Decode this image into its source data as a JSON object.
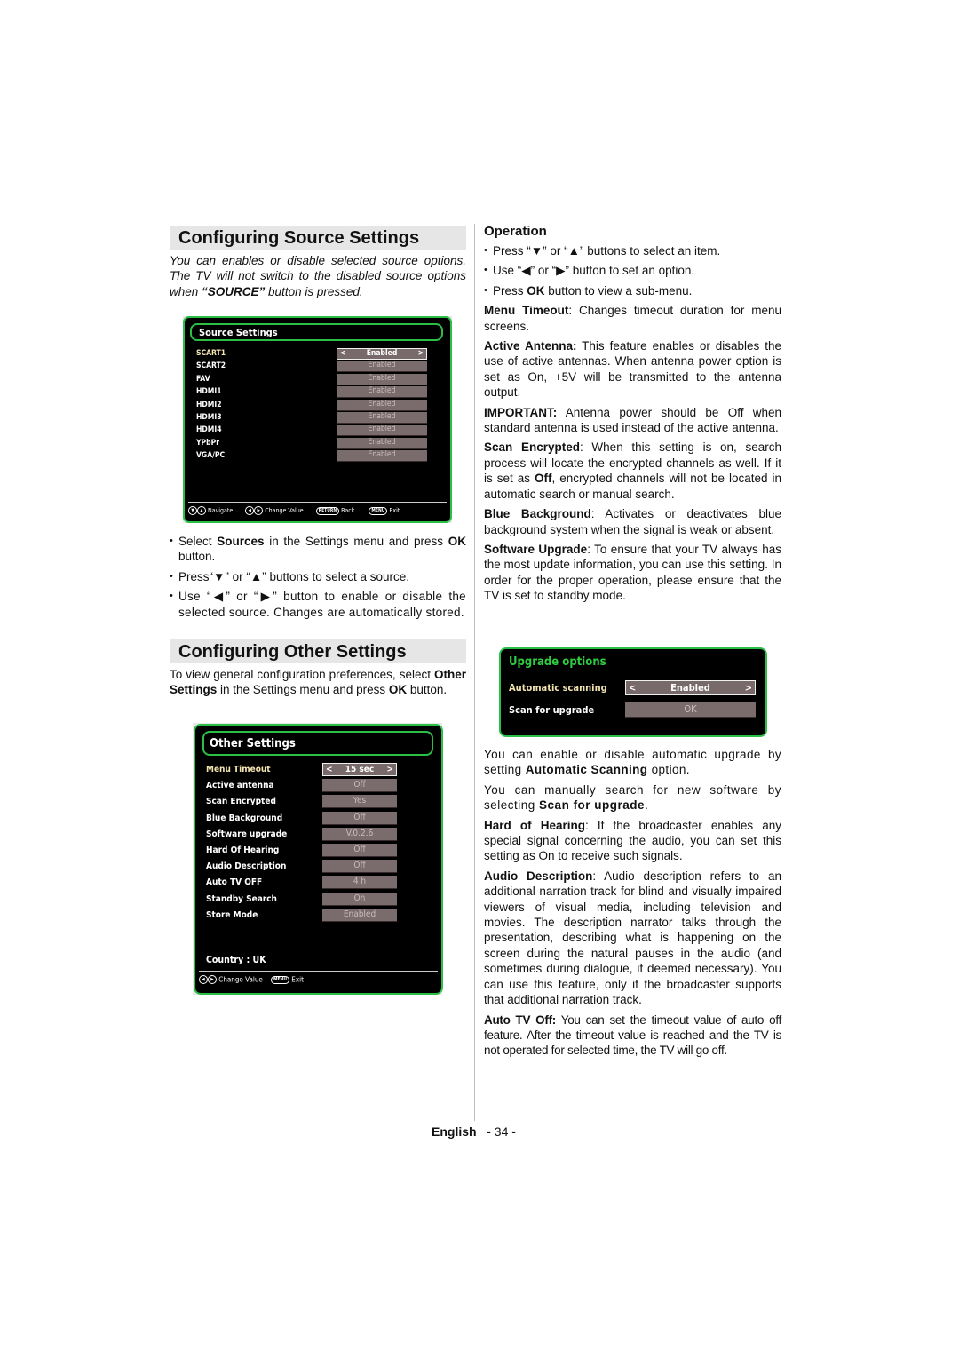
{
  "left": {
    "source_title": "Configuring Source Settings",
    "source_intro_1": "You can enables or disable selected source options. The TV will not switch to the disabled source options when ",
    "source_intro_bold": "“SOURCE”",
    "source_intro_2": " button is pressed.",
    "source_screen": {
      "title": "Source Settings",
      "rows": [
        {
          "label": "SCART1",
          "value": "Enabled",
          "selected": true
        },
        {
          "label": "SCART2",
          "value": "Enabled"
        },
        {
          "label": "FAV",
          "value": "Enabled"
        },
        {
          "label": "HDMI1",
          "value": "Enabled"
        },
        {
          "label": "HDMI2",
          "value": "Enabled"
        },
        {
          "label": "HDMI3",
          "value": "Enabled"
        },
        {
          "label": "HDMI4",
          "value": "Enabled"
        },
        {
          "label": "YPbPr",
          "value": "Enabled"
        },
        {
          "label": "VGA/PC",
          "value": "Enabled"
        }
      ],
      "footer": {
        "navigate": "Navigate",
        "change_value": "Change Value",
        "back_key": "RETURN",
        "back": "Back",
        "menu_key": "MENU",
        "exit": "Exit"
      }
    },
    "source_bullets": [
      {
        "pre": "Select ",
        "b1": "Sources",
        "mid": " in the Settings menu and press ",
        "b2": "OK",
        "post": " button."
      },
      {
        "text": "Press“▼” or “▲” buttons to select a source."
      },
      {
        "text": "Use “◀” or “▶” button to enable or disable the selected source. Changes are automatically stored."
      }
    ],
    "other_title": "Configuring Other Settings",
    "other_intro_1": "To view general configuration preferences, select ",
    "other_intro_b1": "Other Settings",
    "other_intro_2": " in the Settings menu and press ",
    "other_intro_b2": "OK",
    "other_intro_3": " button.",
    "other_screen": {
      "title": "Other Settings",
      "rows": [
        {
          "label": "Menu Timeout",
          "value": "15 sec",
          "selected": true
        },
        {
          "label": "Active antenna",
          "value": "Off"
        },
        {
          "label": "Scan Encrypted",
          "value": "Yes"
        },
        {
          "label": "Blue Background",
          "value": "Off"
        },
        {
          "label": "Software upgrade",
          "value": "V.0.2.6"
        },
        {
          "label": "Hard Of Hearing",
          "value": "Off"
        },
        {
          "label": "Audio Description",
          "value": "Off"
        },
        {
          "label": "Auto TV OFF",
          "value": "4 h"
        },
        {
          "label": "Standby Search",
          "value": "On"
        },
        {
          "label": "Store Mode",
          "value": "Enabled"
        }
      ],
      "country": "Country : UK",
      "footer": {
        "change_value": "Change Value",
        "menu_key": "MENU",
        "exit": "Exit"
      }
    }
  },
  "right": {
    "operation_title": "Operation",
    "op_bullets": [
      {
        "text": "Press “▼” or “▲” buttons to select an item."
      },
      {
        "text": "Use “◀” or “▶” button to set an option."
      },
      {
        "pre": "Press ",
        "b": "OK",
        "post": " button to view a sub-menu."
      }
    ],
    "paras": [
      {
        "b": "Menu Timeout",
        "t": ": Changes timeout duration for menu screens."
      },
      {
        "b": "Active Antenna:",
        "t": " This feature enables or disables the use of active antennas. When antenna power option is set as On, +5V will be transmitted to the antenna output."
      },
      {
        "b": "IMPORTANT:",
        "t": " Antenna power should be Off when standard antenna is used instead of the active antenna."
      },
      {
        "b": "Scan Encrypted",
        "t": ": When this setting is on, search process will locate the encrypted channels as well. If it is set as ",
        "b2": "Off",
        "t2": ", encrypted channels will not be located in automatic search or manual search."
      },
      {
        "b": "Blue Background",
        "t": ": Activates or deactivates blue background system when the signal is weak or absent."
      },
      {
        "b": "Software Upgrade",
        "t": ": To ensure that your TV always has the most update information, you can use this setting. In order for the proper operation, please ensure that the TV is set to standby mode."
      }
    ],
    "upgrade_screen": {
      "title": "Upgrade options",
      "rows": [
        {
          "label": "Automatic scanning",
          "value": "Enabled",
          "selected": true
        },
        {
          "label": "Scan for upgrade",
          "value": "OK"
        }
      ]
    },
    "paras2": [
      {
        "t": "You can enable or disable automatic upgrade by setting ",
        "b": "Automatic Scanning",
        "t2": " option."
      },
      {
        "t": "You can manually search for new software by selecting ",
        "b": "Scan for upgrade",
        "t2": "."
      },
      {
        "b0": "Hard of Hearing",
        "t": ": If the broadcaster enables any special signal concerning the audio, you can set this setting as On to receive such signals."
      },
      {
        "b0": "Audio Description",
        "t": ": Audio description refers to an additional narration track for blind and visually impaired viewers of visual media, including television and movies. The description narrator talks through the presentation, describing what is happening on the screen during the natural pauses in the audio (and sometimes during dialogue, if deemed necessary). You can use this feature, only if the broadcaster supports that additional narration track."
      },
      {
        "b0": "Auto TV Off:",
        "t": " You can set the timeout value of auto off feature. After the timeout value is reached and the TV is not operated for selected time, the TV will go off."
      }
    ]
  },
  "footer": {
    "language": "English",
    "page": "- 34 -"
  },
  "colors": {
    "tv_border": "#2bbf45",
    "tv_value_bg": "#7a6c6c",
    "heading_bg": "#e6e6e6",
    "upgrade_title": "#2ecc40"
  }
}
